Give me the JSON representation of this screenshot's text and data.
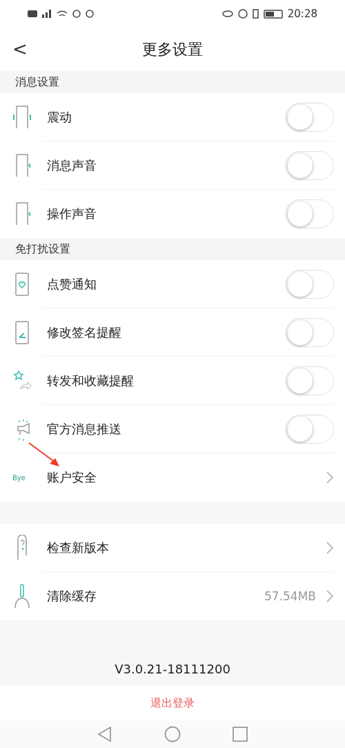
{
  "status_bar": {
    "time": "20:28"
  },
  "header": {
    "back": "<",
    "title": "更多设置"
  },
  "sections": [
    {
      "title": "消息设置",
      "rows": [
        {
          "kind": "toggle",
          "label": "震动",
          "on": false
        },
        {
          "kind": "toggle",
          "label": "消息声音",
          "on": false
        },
        {
          "kind": "toggle",
          "label": "操作声音",
          "on": false
        }
      ]
    },
    {
      "title": "免打扰设置",
      "rows": [
        {
          "kind": "toggle",
          "label": "点赞通知",
          "on": false
        },
        {
          "kind": "toggle",
          "label": "修改签名提醒",
          "on": false
        },
        {
          "kind": "toggle",
          "label": "转发和收藏提醒",
          "on": false
        },
        {
          "kind": "toggle",
          "label": "官方消息推送",
          "on": false
        },
        {
          "kind": "link",
          "icon_text": "Bye",
          "label": "账户安全"
        }
      ]
    },
    {
      "rows": [
        {
          "kind": "link",
          "label": "检查新版本"
        },
        {
          "kind": "link",
          "label": "清除缓存",
          "value": "57.54MB"
        }
      ]
    }
  ],
  "version": "V3.0.21-18111200",
  "logout": "退出登录"
}
